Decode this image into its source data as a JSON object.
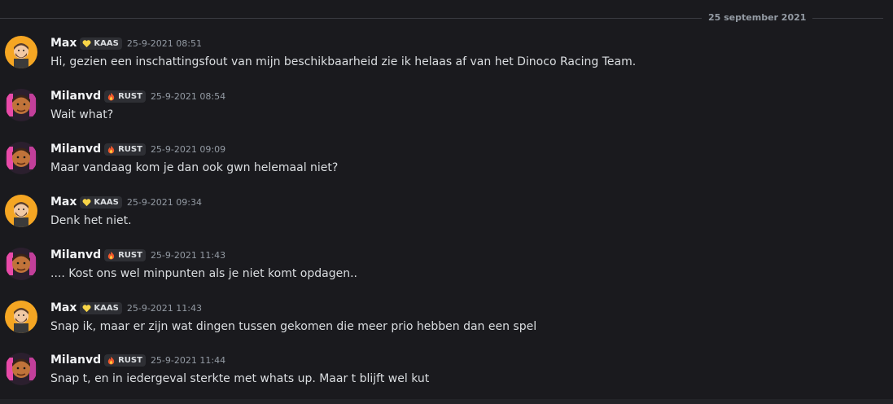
{
  "date_divider": {
    "label": "25 september 2021"
  },
  "colors": {
    "background": "#1a1a1e",
    "text": "#dbdee1",
    "username": "#f2f3f5",
    "muted": "#949ba4",
    "tag_bg": "#2e2f34"
  },
  "messages": [
    {
      "author": "Max",
      "tag": "KAAS",
      "tag_icon": "yellow-heart-icon",
      "avatar": "max-avatar",
      "timestamp": "25-9-2021 08:51",
      "text": "Hi, gezien een inschattingsfout van mijn beschikbaarheid zie ik helaas af van het Dinoco Racing Team."
    },
    {
      "author": "Milanvd",
      "tag": "RUST",
      "tag_icon": "fire-icon",
      "avatar": "milanvd-avatar",
      "timestamp": "25-9-2021 08:54",
      "text": "Wait what?"
    },
    {
      "author": "Milanvd",
      "tag": "RUST",
      "tag_icon": "fire-icon",
      "avatar": "milanvd-avatar",
      "timestamp": "25-9-2021 09:09",
      "text": "Maar vandaag kom je dan ook gwn helemaal niet?"
    },
    {
      "author": "Max",
      "tag": "KAAS",
      "tag_icon": "yellow-heart-icon",
      "avatar": "max-avatar",
      "timestamp": "25-9-2021 09:34",
      "text": "Denk het niet."
    },
    {
      "author": "Milanvd",
      "tag": "RUST",
      "tag_icon": "fire-icon",
      "avatar": "milanvd-avatar",
      "timestamp": "25-9-2021 11:43",
      "text": ".... Kost ons wel minpunten als je niet komt opdagen.."
    },
    {
      "author": "Max",
      "tag": "KAAS",
      "tag_icon": "yellow-heart-icon",
      "avatar": "max-avatar",
      "timestamp": "25-9-2021 11:43",
      "text": "Snap ik, maar er zijn wat dingen tussen gekomen die meer prio hebben dan een spel"
    },
    {
      "author": "Milanvd",
      "tag": "RUST",
      "tag_icon": "fire-icon",
      "avatar": "milanvd-avatar",
      "timestamp": "25-9-2021 11:44",
      "text": "Snap t, en in iedergeval sterkte met whats up. Maar t blijft wel kut"
    }
  ]
}
